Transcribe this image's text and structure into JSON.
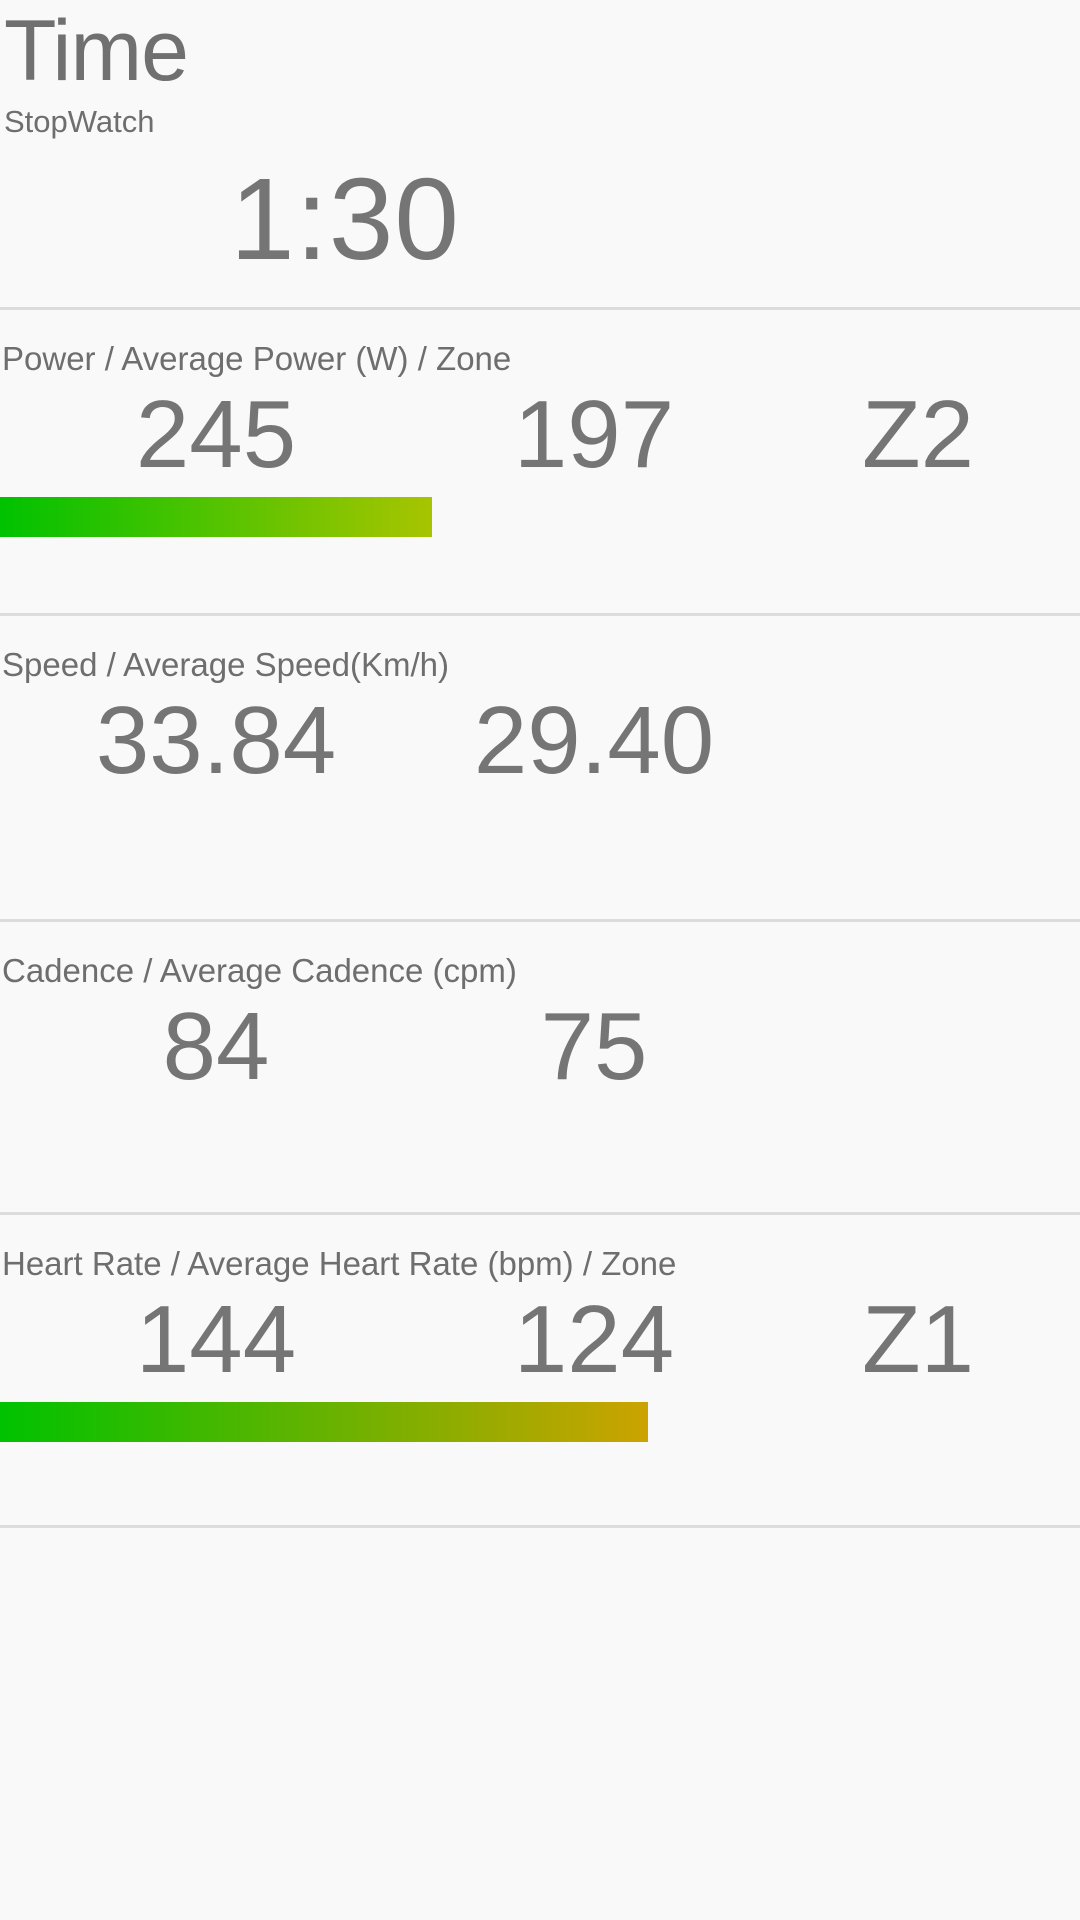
{
  "header": {
    "title": "Time",
    "subtitle": "StopWatch",
    "timer": "1:30"
  },
  "sections": {
    "power": {
      "label": "Power / Average Power (W) / Zone",
      "current": "245",
      "average": "197",
      "zone": "Z2",
      "bar": {
        "fill_percent": 40,
        "color_start": "#00c200",
        "color_end": "#a8c400"
      }
    },
    "speed": {
      "label": "Speed / Average Speed(Km/h)",
      "current": "33.84",
      "average": "29.40"
    },
    "cadence": {
      "label": "Cadence / Average Cadence (cpm)",
      "current": "84",
      "average": "75"
    },
    "heartrate": {
      "label": "Heart Rate / Average Heart Rate (bpm) / Zone",
      "current": "144",
      "average": "124",
      "zone": "Z1",
      "bar": {
        "fill_percent": 60,
        "color_start": "#00c200",
        "color_end": "#cca300"
      }
    }
  },
  "theme": {
    "background": "#f9f9f9",
    "text": "#6e6e6e",
    "value_text": "#757575",
    "divider": "#dcdcdc"
  }
}
